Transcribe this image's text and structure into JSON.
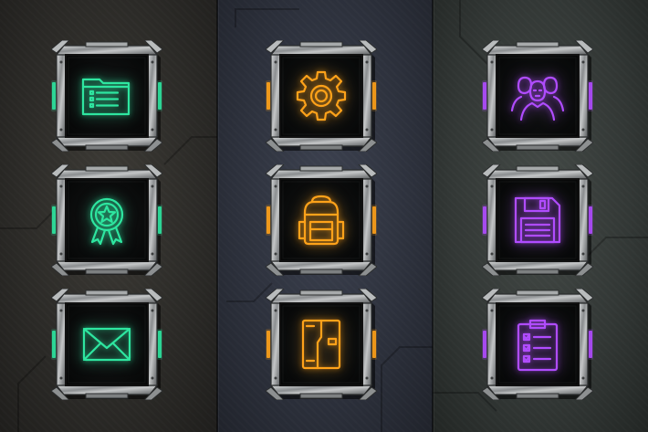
{
  "theme_colors": {
    "green": "#2ee6a0",
    "orange": "#ffa21a",
    "purple": "#b04cff"
  },
  "columns": [
    {
      "name": "green",
      "accent": "#2ee6a0",
      "glow": "rgba(46,230,160,0.55)",
      "icons": [
        "folder-icon",
        "award-badge-icon",
        "mail-icon"
      ]
    },
    {
      "name": "orange",
      "accent": "#ffa21a",
      "glow": "rgba(255,162,26,0.55)",
      "icons": [
        "gear-icon",
        "backpack-icon",
        "door-icon"
      ]
    },
    {
      "name": "purple",
      "accent": "#b04cff",
      "glow": "rgba(176,76,255,0.55)",
      "icons": [
        "group-icon",
        "floppy-disk-icon",
        "clipboard-checklist-icon"
      ]
    }
  ]
}
